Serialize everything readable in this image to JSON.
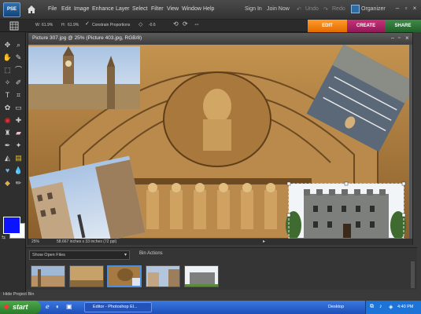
{
  "app": {
    "logo_text": "PSE",
    "title_tab": "Editor - Photoshop El..."
  },
  "menu": {
    "items": [
      "File",
      "Edit",
      "Image",
      "Enhance",
      "Layer",
      "Select",
      "Filter",
      "View",
      "Window",
      "Help"
    ],
    "right": {
      "sign_in": "Sign In",
      "join_now": "Join Now",
      "undo": "Undo",
      "redo": "Redo",
      "organizer": "Organizer"
    }
  },
  "options": {
    "w_label": "W:",
    "w_value": "61.9%",
    "h_label": "H:",
    "h_value": "61.9%",
    "constrain_label": "Constrain Proportions",
    "angle_value": "-0.6"
  },
  "mode_tabs": {
    "edit": "EDIT",
    "create": "CREATE",
    "share": "SHARE"
  },
  "document": {
    "title": "Picture 307.jpg @ 25% (Picture 403.jpg, RGB/8)",
    "zoom": "25%",
    "doc_size": "58.667 inches x 33 inches (72 ppi)"
  },
  "bin": {
    "show_label": "Show Open Files",
    "actions_label": "Bin Actions",
    "hide_label": "Hide Project Bin",
    "thumbs": [
      "thumb-1",
      "thumb-2",
      "thumb-3",
      "thumb-4",
      "thumb-5"
    ],
    "selected_index": 2
  },
  "taskbar": {
    "start": "start",
    "task": "Editor - Photoshop El...",
    "desktop": "Desktop",
    "time": "4:40 PM"
  },
  "colors": {
    "foreground": "#0a14ff",
    "background": "#ffffff",
    "edit_tab": "#ff8a1a",
    "create_tab": "#b0286a",
    "share_tab": "#348040"
  }
}
